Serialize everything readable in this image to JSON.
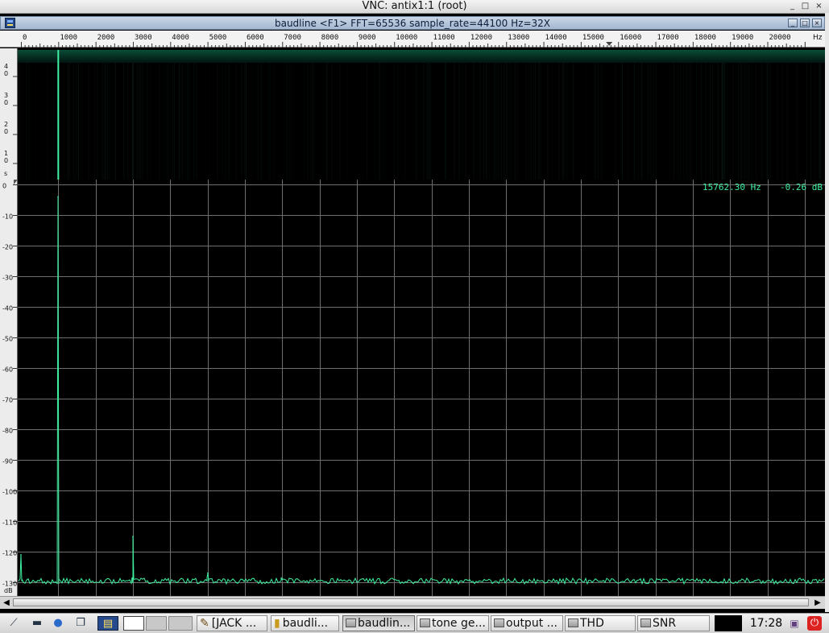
{
  "vnc_window": {
    "title": "VNC: antix1:1 (root)",
    "minimize": "_",
    "maximize": "□",
    "close": "×"
  },
  "app_window": {
    "title": "baudline  <F1> FFT=65536 sample_rate=44100 Hz=32X",
    "minimize": "_",
    "maximize": "□",
    "close": "×"
  },
  "ruler": {
    "ticks": [
      {
        "hz": 0,
        "label": "0"
      },
      {
        "hz": 1000,
        "label": "1000"
      },
      {
        "hz": 2000,
        "label": "2000"
      },
      {
        "hz": 3000,
        "label": "3000"
      },
      {
        "hz": 4000,
        "label": "4000"
      },
      {
        "hz": 5000,
        "label": "5000"
      },
      {
        "hz": 6000,
        "label": "6000"
      },
      {
        "hz": 7000,
        "label": "7000"
      },
      {
        "hz": 8000,
        "label": "8000"
      },
      {
        "hz": 9000,
        "label": "9000"
      },
      {
        "hz": 10000,
        "label": "10000"
      },
      {
        "hz": 11000,
        "label": "11000"
      },
      {
        "hz": 12000,
        "label": "12000"
      },
      {
        "hz": 13000,
        "label": "13000"
      },
      {
        "hz": 14000,
        "label": "14000"
      },
      {
        "hz": 15000,
        "label": "15000"
      },
      {
        "hz": 16000,
        "label": "16000"
      },
      {
        "hz": 17000,
        "label": "17000"
      },
      {
        "hz": 18000,
        "label": "18000"
      },
      {
        "hz": 19000,
        "label": "19000"
      },
      {
        "hz": 20000,
        "label": "20000"
      }
    ],
    "unit": "Hz",
    "cursor_hz": 15762.3,
    "max_hz": 21500
  },
  "waterfall": {
    "time_labels": [
      "4\n0",
      "3\n0",
      "2\n0",
      "1\n0"
    ],
    "time_unit": "s",
    "tone_hz": 1000,
    "faint_hz": 3000
  },
  "readout": {
    "frequency": "15762.30 Hz",
    "level": "-0.26 dB"
  },
  "chart_data": {
    "type": "line",
    "xlabel": "Hz",
    "ylabel": "dB",
    "xlim": [
      0,
      21500
    ],
    "ylim": [
      -130,
      0
    ],
    "y_ticks": [
      0,
      -10,
      -20,
      -30,
      -40,
      -50,
      -60,
      -70,
      -80,
      -90,
      -100,
      -110,
      -120,
      -130
    ],
    "y_unit": "dB",
    "grid": true,
    "series": [
      {
        "peaks": [
          {
            "x": 0,
            "y": -121
          },
          {
            "x": 1000,
            "y": -4
          },
          {
            "x": 3000,
            "y": -115
          },
          {
            "x": 5000,
            "y": -127
          },
          {
            "x": 7000,
            "y": -129
          }
        ],
        "noise_floor": -130
      }
    ],
    "colors": {
      "trace": "#3ff0a0",
      "grid": "#6e6e6e"
    }
  },
  "taskbar": {
    "tasks": [
      {
        "label": "[JACK ...",
        "active": false
      },
      {
        "label": "baudli...",
        "active": false
      },
      {
        "label": "baudlin...",
        "active": true
      },
      {
        "label": "tone ge...",
        "active": false
      },
      {
        "label": "output ...",
        "active": false
      },
      {
        "label": "THD",
        "active": false
      },
      {
        "label": "SNR",
        "active": false
      }
    ],
    "clock": "17:28"
  }
}
